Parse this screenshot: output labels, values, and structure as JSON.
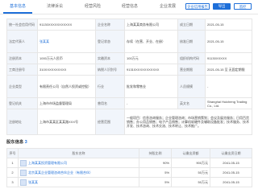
{
  "tabs": [
    "基本信息",
    "法律诉讼",
    "经营风险",
    "经营信息",
    "企业发展"
  ],
  "actions": {
    "export": "导出",
    "report": "企业信用报告",
    "monitor": "监控"
  },
  "info_rows": [
    [
      "统一社会信用代码",
      "91130XXXXXXXXXXX",
      "企业名称",
      "上海某某商务有限公司",
      "成立日期",
      "2021-05-15"
    ],
    [
      "法定代表人",
      "张某某",
      "登记状态",
      "存续（在营、开业、在册）",
      "核准日期",
      "2021-05-15"
    ],
    [
      "注册资本",
      "1000万元人民币",
      "实缴资本",
      "100万元",
      "组织机构代码",
      "91130XXXXX"
    ],
    [
      "工商注册号",
      "310XXXXXXXXXX",
      "纳税人识别号",
      "91310XXXXXXXXXXX",
      "营业期限",
      "2021-05-15 至 无固定期限"
    ],
    [
      "企业类型",
      "有限责任公司（自然人投资或控股）",
      "行业",
      "批发和零售业",
      "人员规模",
      "-"
    ],
    [
      "登记机关",
      "上海市市场监督管理局",
      "曾用名",
      "-",
      "英文名",
      "Shanghai Huicheng Trading Co., Ltd."
    ],
    [
      "注册地址",
      "上海市某某区某某路XXX号",
      "经营范围",
      "一般项目：信息咨询服务；企业管理咨询；市场营销策划；会议及展览服务；日用百货销售；办公用品销售；电子产品销售；计算机软硬件及辅助设备批发；技术服务、技术开发、技术咨询、技术交流、技术转让、技术推广。"
    ]
  ],
  "shareholders": {
    "title": "股东信息",
    "count": "3",
    "columns": [
      "序号",
      "股东名称",
      "持股比例",
      "认缴出资额",
      "认缴出资日期"
    ],
    "rows": [
      [
        "1",
        "上海某某投资管理有限公司",
        "90%",
        "900万元",
        "2041-05-15"
      ],
      [
        "2",
        "北京某某企业管理咨询合伙企业（有限合伙）",
        "5%",
        "50万元",
        "2041-05-15"
      ],
      [
        "3",
        "张某某",
        "5%",
        "50万元",
        "2041-05-15"
      ]
    ]
  }
}
